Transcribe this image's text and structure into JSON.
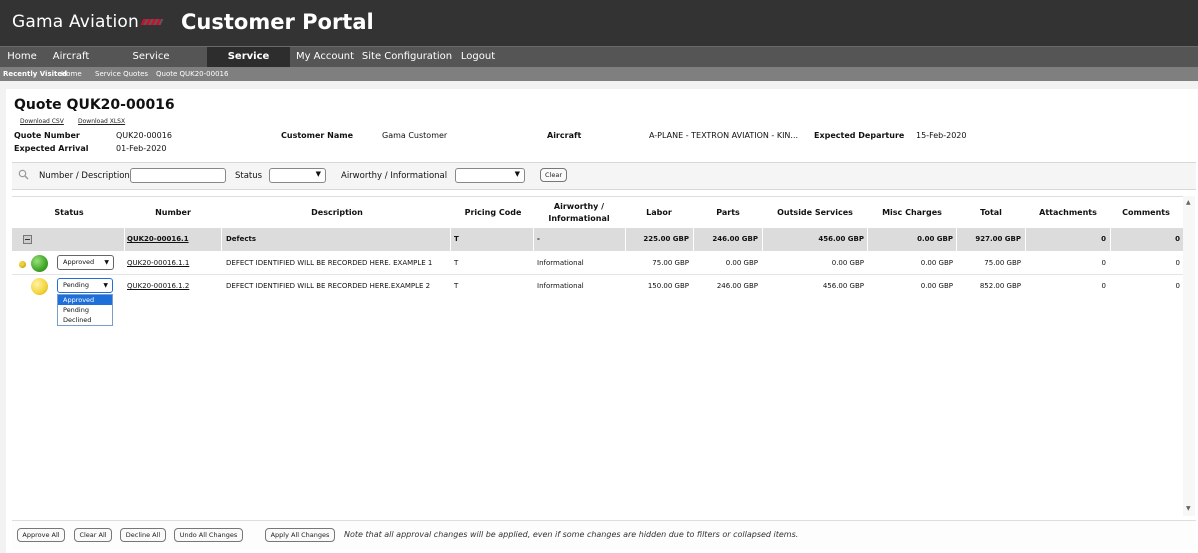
{
  "header": {
    "logo": "Gama Aviation",
    "title": "Customer Portal"
  },
  "nav": [
    "Home",
    "Aircraft",
    "Service Status/History",
    "Service Quotes",
    "My Account",
    "Site Configuration",
    "Logout"
  ],
  "breadcrumbs": {
    "label": "Recently Visited",
    "items": [
      "Home",
      "Service Quotes",
      "Quote QUK20-00016"
    ]
  },
  "quote": {
    "title": "Quote QUK20-00016",
    "download_csv": "Download CSV",
    "download_xlsx": "Download XLSX",
    "fields": {
      "quote_number_label": "Quote Number",
      "quote_number": "QUK20-00016",
      "customer_name_label": "Customer Name",
      "customer_name": "Gama Customer",
      "aircraft_label": "Aircraft",
      "aircraft": "A-PLANE - TEXTRON AVIATION - KIN...",
      "departure_label": "Expected Departure",
      "departure": "15-Feb-2020",
      "arrival_label": "Expected Arrival",
      "arrival": "01-Feb-2020"
    }
  },
  "filters": {
    "number_label": "Number / Description",
    "status_label": "Status",
    "airworthy_label": "Airworthy / Informational",
    "clear": "Clear"
  },
  "columns": [
    "Status",
    "Number",
    "Description",
    "Pricing Code",
    "Airworthy / Informational",
    "Labor",
    "Parts",
    "Outside Services",
    "Misc Charges",
    "Total",
    "Attachments",
    "Comments"
  ],
  "group": {
    "number": "QUK20-00016.1",
    "description": "Defects",
    "pricing": "T",
    "airworthy": "-",
    "labor": "225.00 GBP",
    "parts": "246.00 GBP",
    "outside": "456.00 GBP",
    "misc": "0.00 GBP",
    "total": "927.00 GBP",
    "attachments": "0",
    "comments": "0"
  },
  "rows": [
    {
      "status": "Approved",
      "number": "QUK20-00016.1.1",
      "description": "DEFECT IDENTIFIED WILL BE RECORDED HERE. EXAMPLE 1",
      "pricing": "T",
      "airworthy": "Informational",
      "labor": "75.00 GBP",
      "parts": "0.00 GBP",
      "outside": "0.00 GBP",
      "misc": "0.00 GBP",
      "total": "75.00 GBP",
      "attachments": "0",
      "comments": "0"
    },
    {
      "status": "Pending",
      "number": "QUK20-00016.1.2",
      "description": "DEFECT IDENTIFIED WILL BE RECORDED HERE.EXAMPLE 2",
      "pricing": "T",
      "airworthy": "Informational",
      "labor": "150.00 GBP",
      "parts": "246.00 GBP",
      "outside": "456.00 GBP",
      "misc": "0.00 GBP",
      "total": "852.00 GBP",
      "attachments": "0",
      "comments": "0"
    }
  ],
  "status_options": [
    "Approved",
    "Pending",
    "Declined"
  ],
  "footer": {
    "approve_all": "Approve All",
    "clear_all": "Clear All",
    "decline_all": "Decline All",
    "undo_all": "Undo All Changes",
    "apply_all": "Apply All Changes",
    "note": "Note that all approval changes will be applied, even if some changes are hidden due to filters or collapsed items."
  },
  "colors": {
    "header_bg": "#333333",
    "nav_bg": "#555555",
    "active_nav": "#2d2d2d",
    "status_green": "#3fa528",
    "status_yellow": "#f2d43a",
    "dropdown_selected": "#1e6fd9"
  }
}
